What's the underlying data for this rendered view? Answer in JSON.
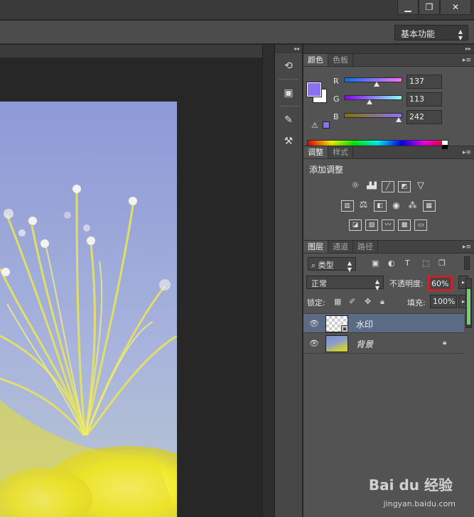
{
  "window": {
    "minimize": "▁",
    "restore": "❐",
    "close": "✕"
  },
  "options_bar": {
    "workspace": "基本功能"
  },
  "color_panel": {
    "tabs": [
      "颜色",
      "色板"
    ],
    "r_label": "R",
    "g_label": "G",
    "b_label": "B",
    "r": "137",
    "g": "113",
    "b": "242",
    "foreground_color": "#8971f2",
    "background_color": "#ffffff"
  },
  "adjustments_panel": {
    "tabs": [
      "调整",
      "样式"
    ],
    "title": "添加调整"
  },
  "layers_panel": {
    "tabs": [
      "图层",
      "通道",
      "路径"
    ],
    "filter": "类型",
    "blend_mode": "正常",
    "opacity_label": "不透明度:",
    "opacity": "60%",
    "lock_label": "锁定:",
    "fill_label": "填充:",
    "fill": "100%",
    "layers": [
      {
        "name": "水印",
        "selected": true
      },
      {
        "name": "背景",
        "selected": false
      }
    ]
  },
  "watermark": {
    "brand": "Bai du 经验",
    "url": "jingyan.baidu.com"
  }
}
